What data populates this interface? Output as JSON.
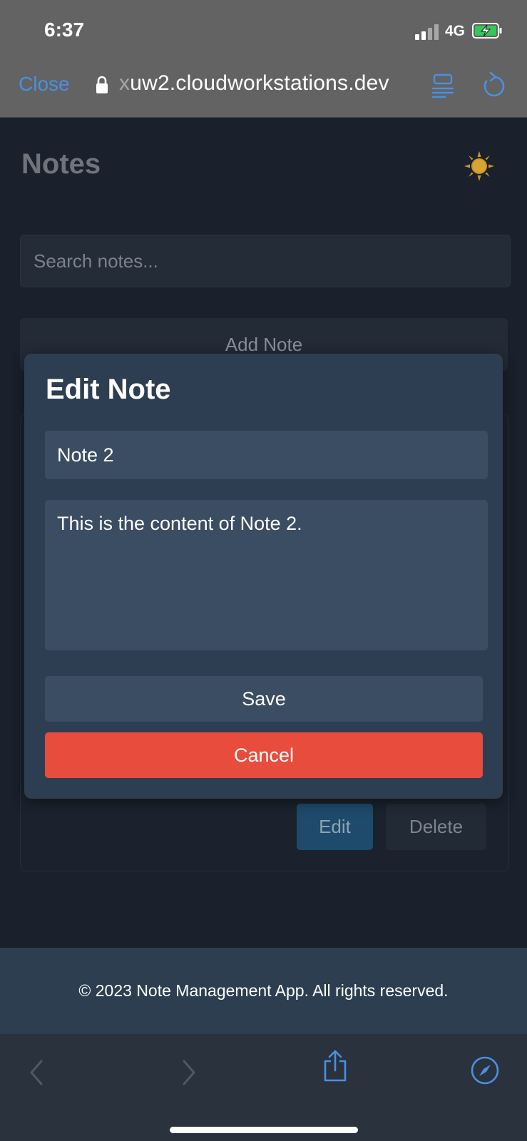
{
  "status_bar": {
    "time": "6:37",
    "network": "4G"
  },
  "browser": {
    "close_label": "Close",
    "url_dim": "x",
    "url_main": "uw2.cloudworkstations.dev"
  },
  "app": {
    "title": "Notes",
    "theme_icon": "sun-icon",
    "search_placeholder": "Search notes...",
    "add_note_label": "Add Note"
  },
  "background_card": {
    "edit_label": "Edit",
    "delete_label": "Delete"
  },
  "modal": {
    "title": "Edit Note",
    "note_title_value": "Note 2",
    "note_content_value": "This is the content of Note 2.",
    "save_label": "Save",
    "cancel_label": "Cancel"
  },
  "footer": {
    "text": "© 2023 Note Management App. All rights reserved."
  },
  "toolbar": {
    "icons": [
      "back-icon",
      "forward-icon",
      "share-icon",
      "compass-icon"
    ]
  },
  "colors": {
    "accent": "#4a90e2",
    "danger": "#e74c3c",
    "modal_bg": "#2e3e52",
    "footer_bg": "#2c3e50"
  }
}
